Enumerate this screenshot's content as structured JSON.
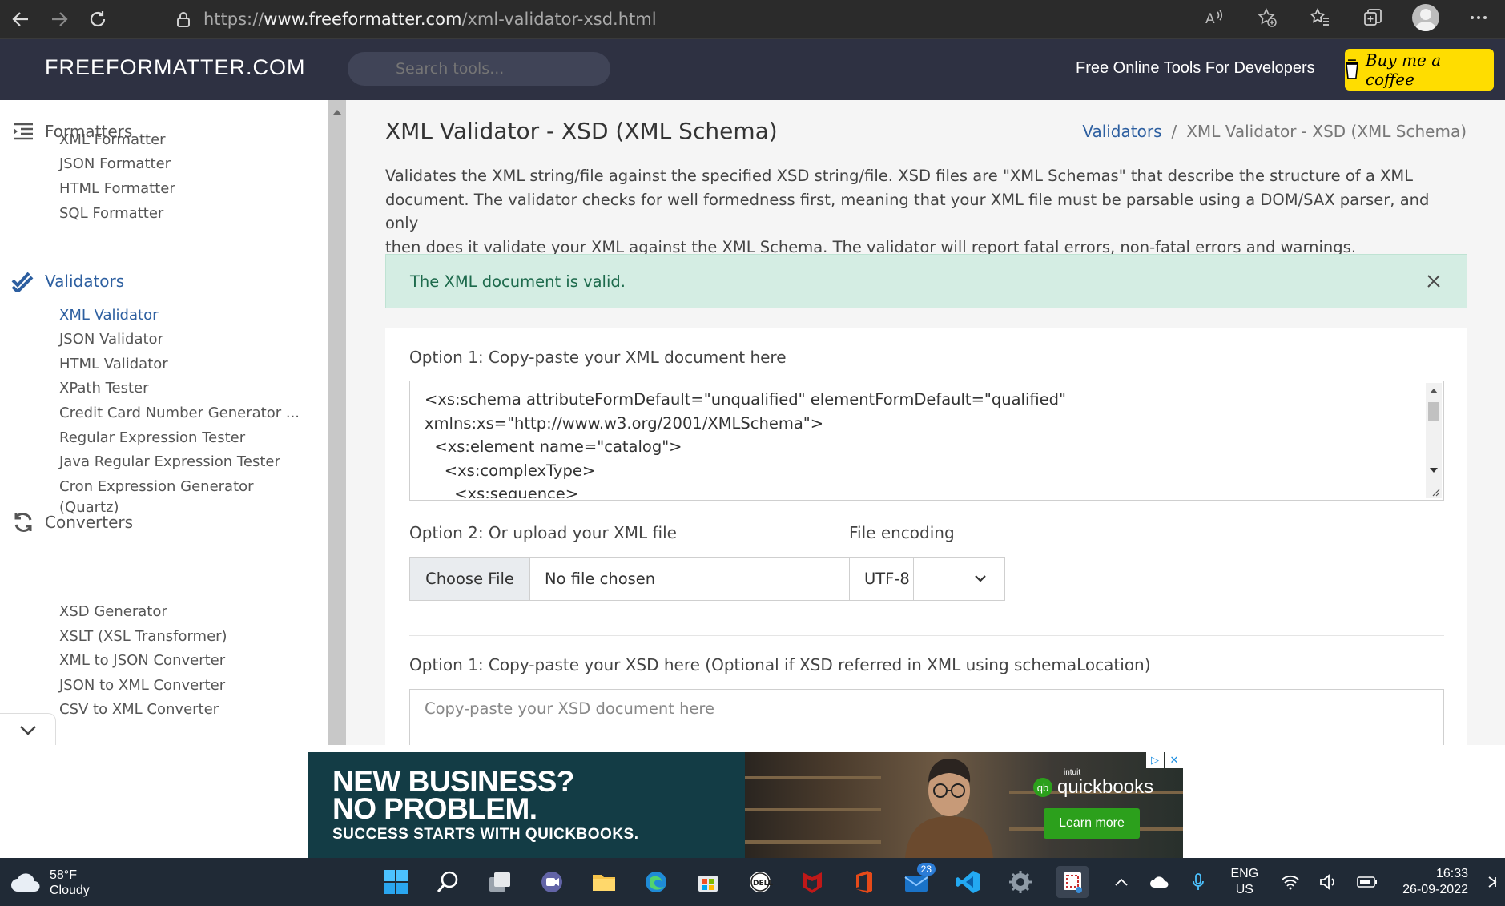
{
  "browser": {
    "url_prefix": "https://",
    "url_domain": "www.freeformatter.com",
    "url_path": "/xml-validator-xsd.html"
  },
  "header": {
    "logo": "FREEFORMATTER.COM",
    "search_placeholder": "Search tools...",
    "tagline": "Free Online Tools For Developers",
    "coffee_label": "Buy me a coffee"
  },
  "sidebar": {
    "groups": [
      {
        "label": "Formatters",
        "items": [
          "XML Formatter",
          "JSON Formatter",
          "HTML Formatter",
          "SQL Formatter"
        ]
      },
      {
        "label": "Validators",
        "items": [
          "XML Validator",
          "JSON Validator",
          "HTML Validator",
          "XPath Tester",
          "Credit Card Number Generator ...",
          "Regular Expression Tester",
          "Java Regular Expression Tester",
          "Cron Expression Generator",
          "(Quartz)"
        ]
      },
      {
        "label": "Converters",
        "items": [
          "XSD Generator",
          "XSLT (XSL Transformer)",
          "XML to JSON Converter",
          "JSON to XML Converter",
          "CSV to XML Converter"
        ]
      }
    ]
  },
  "main": {
    "title": "XML Validator - XSD (XML Schema)",
    "breadcrumb": {
      "parent": "Validators",
      "separator": "/",
      "current": "XML Validator - XSD (XML Schema)"
    },
    "description_lines": [
      "Validates the XML string/file against the specified XSD string/file. XSD files are \"XML Schemas\" that describe the structure of a XML",
      "document. The validator checks for well formedness first, meaning that your XML file must be parsable using a DOM/SAX parser, and only",
      "then does it validate your XML against the XML Schema. The validator will report fatal errors, non-fatal errors and warnings."
    ],
    "alert": "The XML document is valid.",
    "xml_option_label": "Option 1: Copy-paste your XML document here",
    "xml_value": "<xs:schema attributeFormDefault=\"unqualified\" elementFormDefault=\"qualified\"\nxmlns:xs=\"http://www.w3.org/2001/XMLSchema\">\n  <xs:element name=\"catalog\">\n    <xs:complexType>\n      <xs:sequence>",
    "upload_label": "Option 2: Or upload your XML file",
    "choose_file": "Choose File",
    "no_file": "No file chosen",
    "encoding_label": "File encoding",
    "encoding_value": "UTF-8",
    "xsd_option_label": "Option 1: Copy-paste your XSD here (Optional if XSD referred in XML using schemaLocation)",
    "xsd_placeholder": "Copy-paste your XSD document here"
  },
  "ad": {
    "headline_1": "NEW BUSINESS?",
    "headline_2": "NO PROBLEM.",
    "subline": "SUCCESS STARTS WITH QUICKBOOKS.",
    "brand_small": "intuit",
    "brand": "quickbooks",
    "brand_mark": "qb",
    "cta": "Learn more"
  },
  "taskbar": {
    "temperature": "58°F",
    "condition": "Cloudy",
    "badge_count": "23",
    "lang_1": "ENG",
    "lang_2": "US",
    "time": "16:33",
    "date": "26-09-2022"
  },
  "colors": {
    "header_bg": "#2e3142",
    "accent_blue": "#2d5fa0",
    "alert_bg": "#d4ede3",
    "coffee_yellow": "#ffdd00",
    "ad_bg": "#133c45",
    "qb_green": "#2ca01c"
  }
}
